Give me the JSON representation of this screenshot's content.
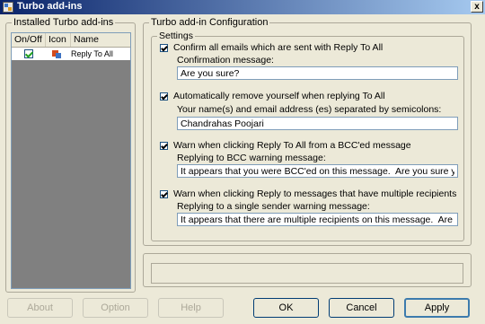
{
  "window": {
    "title": "Turbo add-ins",
    "close_label": "x"
  },
  "installed": {
    "group_title": "Installed Turbo add-ins",
    "columns": [
      "On/Off",
      "Icon",
      "Name"
    ],
    "rows": [
      {
        "enabled": true,
        "icon": "turbo-addin-icon",
        "name": "Reply To All"
      }
    ]
  },
  "config": {
    "group_title": "Turbo add-in Configuration",
    "settings_title": "Settings",
    "options": [
      {
        "checked": true,
        "label": "Confirm all emails which are sent with Reply To All",
        "field_label": "Confirmation message:",
        "field_value": "Are you sure?"
      },
      {
        "checked": true,
        "label": "Automatically remove yourself when replying To All",
        "field_label": "Your name(s) and email address (es) separated by semicolons:",
        "field_value": "Chandrahas Poojari"
      },
      {
        "checked": true,
        "label": "Warn when clicking Reply To All from a BCC'ed message",
        "field_label": "Replying to BCC warning message:",
        "field_value": "It appears that you were BCC'ed on this message.  Are you sure you want to reply t"
      },
      {
        "checked": true,
        "label": "Warn when clicking Reply to messages that have multiple recipients",
        "field_label": "Replying to a single sender warning message:",
        "field_value": "It appears that there are multiple recipients on this message.  Are you sure you war"
      }
    ]
  },
  "buttons": {
    "about": "About",
    "option": "Option",
    "help": "Help",
    "ok": "OK",
    "cancel": "Cancel",
    "apply": "Apply"
  }
}
